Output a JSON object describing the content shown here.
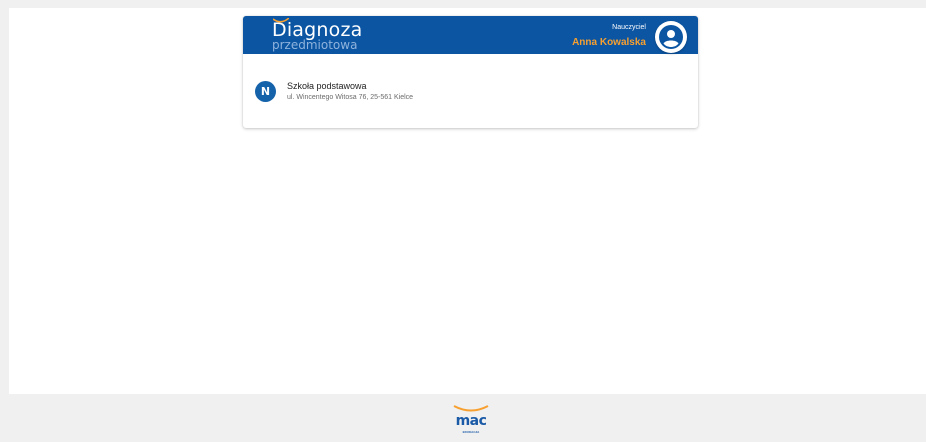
{
  "header": {
    "brand_main": "Diagnoza",
    "brand_sub": "przedmiotowa",
    "role": "Nauczyciel",
    "user_name": "Anna Kowalska",
    "header_color": "#0b55a3",
    "accent_color": "#f7a030"
  },
  "schools": [
    {
      "badge": "N",
      "name": "Szkoła podstawowa",
      "address": "ul. Wincentego Witosa 76, 25-561 Kielce"
    }
  ],
  "footer": {
    "logo_text": "mac",
    "logo_sub": "EDUKACJA"
  },
  "icons": {
    "avatar": "account-circle-icon",
    "logo": "mac-logo"
  }
}
